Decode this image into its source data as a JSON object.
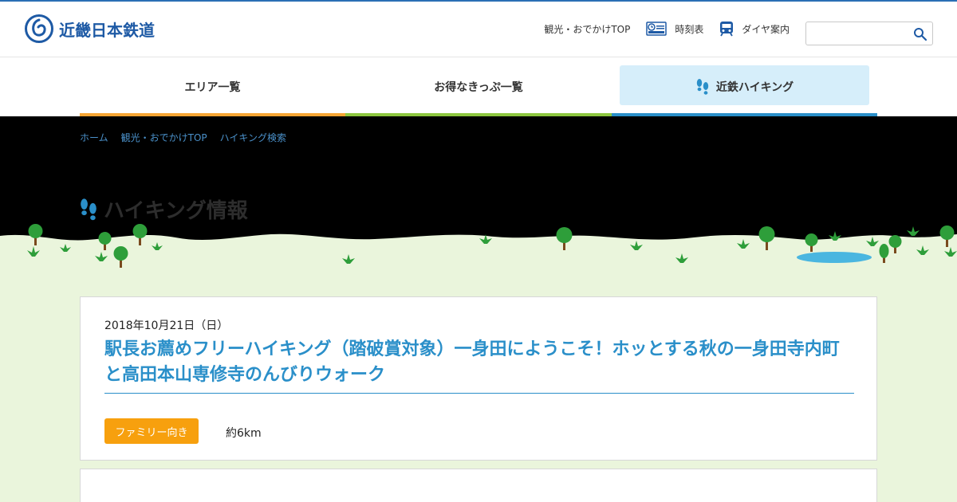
{
  "header": {
    "logo_text": "近畿日本鉄道",
    "nav": [
      {
        "label": "観光・おでかけTOP"
      },
      {
        "label": "時刻表"
      },
      {
        "label": "ダイヤ案内"
      }
    ],
    "search": {
      "placeholder": ""
    }
  },
  "tabs": [
    {
      "label": "エリア一覧",
      "bar_color": "#f7a533"
    },
    {
      "label": "お得なきっぷ一覧",
      "bar_color": "#8cc63f"
    },
    {
      "label": "近鉄ハイキング",
      "bar_color": "#2a8fc9",
      "active": true
    }
  ],
  "breadcrumb": [
    "ホーム",
    "観光・おでかけTOP",
    "ハイキング検索"
  ],
  "hero": {
    "title": "ハイキング情報"
  },
  "event": {
    "date": "2018年10月21日（日）",
    "title": "駅長お薦めフリーハイキング（踏破賞対象）一身田にようこそ！ホッとする秋の一身田寺内町と高田本山専修寺のんびりウォーク",
    "badge": "ファミリー向き",
    "distance": "約6km"
  },
  "colors": {
    "brand": "#1e5aa5",
    "accent": "#2a8fc9",
    "badge": "#f7a00e",
    "ground": "#eaf5dc"
  },
  "icons": [
    "logo-icon",
    "timetable-icon",
    "train-icon",
    "search-icon",
    "footprints-icon"
  ]
}
